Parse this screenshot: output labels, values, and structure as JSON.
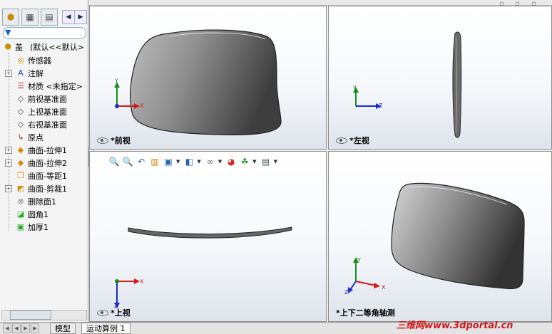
{
  "feature_tree": {
    "part_name": "盖",
    "config": "(默认<<默认>",
    "items": [
      {
        "label": "传感器",
        "icon": "sensor-icon",
        "expand": ""
      },
      {
        "label": "注解",
        "icon": "annotation-icon",
        "expand": "+"
      },
      {
        "label": "材质 <未指定>",
        "icon": "material-icon",
        "expand": ""
      },
      {
        "label": "前视基准面",
        "icon": "plane-icon",
        "expand": ""
      },
      {
        "label": "上视基准面",
        "icon": "plane-icon",
        "expand": ""
      },
      {
        "label": "右视基准面",
        "icon": "plane-icon",
        "expand": ""
      },
      {
        "label": "原点",
        "icon": "origin-icon",
        "expand": ""
      },
      {
        "label": "曲面-拉伸1",
        "icon": "surface-extrude-icon",
        "expand": "+"
      },
      {
        "label": "曲面-拉伸2",
        "icon": "surface-extrude-icon",
        "expand": "+"
      },
      {
        "label": "曲面-等距1",
        "icon": "surface-offset-icon",
        "expand": ""
      },
      {
        "label": "曲面-剪裁1",
        "icon": "surface-trim-icon",
        "expand": "+"
      },
      {
        "label": "删除面1",
        "icon": "delete-face-icon",
        "expand": ""
      },
      {
        "label": "圆角1",
        "icon": "fillet-icon",
        "expand": ""
      },
      {
        "label": "加厚1",
        "icon": "thicken-icon",
        "expand": ""
      }
    ]
  },
  "views": {
    "front": "*前视",
    "left": "*左视",
    "top": "*上视",
    "iso": "*上下二等角轴测"
  },
  "axes": {
    "x": "X",
    "y": "Y",
    "z": "Z"
  },
  "bottom_tabs": {
    "model": "模型",
    "motion": "运动算例 1"
  },
  "watermark": "三维网www.3dportal.cn",
  "colors": {
    "x_axis": "#d21a1a",
    "y_axis": "#1a8a1a",
    "z_axis": "#1a2ad0",
    "part": "#777777"
  }
}
